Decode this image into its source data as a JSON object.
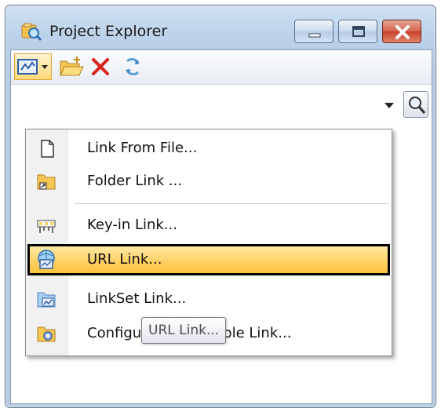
{
  "window": {
    "title": "Project Explorer",
    "icon": "project-explorer-icon",
    "caption_buttons": [
      "minimize-icon",
      "maximize-icon",
      "close-icon"
    ]
  },
  "toolbar": {
    "buttons": [
      {
        "icon": "link-icon",
        "has_dropdown": true
      },
      {
        "icon": "open-folder-icon"
      },
      {
        "icon": "delete-x-icon"
      },
      {
        "icon": "refresh-icon"
      }
    ],
    "search_icon": "magnifier-icon"
  },
  "menu": {
    "items": [
      {
        "label": "Link From File...",
        "icon": "file-icon"
      },
      {
        "label": "Folder Link ...",
        "icon": "folder-link-icon"
      },
      {
        "label": "Key-in Link...",
        "icon": "keyin-link-icon"
      },
      {
        "label": "URL Link...",
        "icon": "url-link-icon",
        "highlighted": true
      },
      {
        "label": "LinkSet Link...",
        "icon": "linkset-icon"
      },
      {
        "label": "Configuration Variable Link...",
        "icon": "config-variable-icon"
      }
    ]
  },
  "tooltip": {
    "text": "URL Link..."
  },
  "colors": {
    "highlight": "#ffd166",
    "highlight_border": "#000000",
    "close_button": "#c7402a",
    "delete_icon": "#d8241b"
  }
}
